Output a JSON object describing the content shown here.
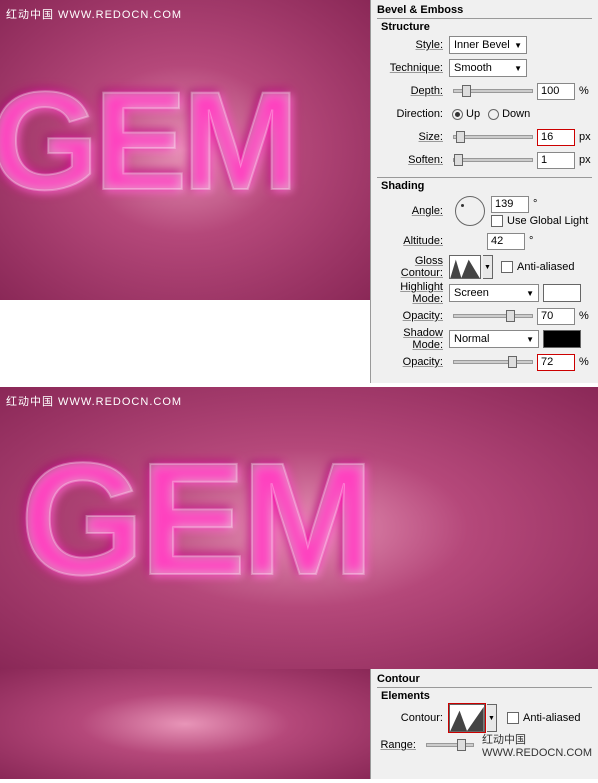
{
  "watermark": "红动中国 WWW.REDOCN.COM",
  "gemtext": "GEM",
  "panel1": {
    "title": "Bevel & Emboss",
    "structure": {
      "legend": "Structure",
      "style": {
        "label": "Style:",
        "value": "Inner Bevel"
      },
      "technique": {
        "label": "Technique:",
        "value": "Smooth"
      },
      "depth": {
        "label": "Depth:",
        "value": "100",
        "unit": "%"
      },
      "direction": {
        "label": "Direction:",
        "up": "Up",
        "down": "Down"
      },
      "size": {
        "label": "Size:",
        "value": "16",
        "unit": "px"
      },
      "soften": {
        "label": "Soften:",
        "value": "1",
        "unit": "px"
      }
    },
    "shading": {
      "legend": "Shading",
      "angle": {
        "label": "Angle:",
        "value": "139",
        "unit": "°"
      },
      "globalLight": "Use Global Light",
      "altitude": {
        "label": "Altitude:",
        "value": "42",
        "unit": "°"
      },
      "glossContour": {
        "label": "Gloss Contour:",
        "antiAliased": "Anti-aliased"
      },
      "highlightMode": {
        "label": "Highlight Mode:",
        "value": "Screen"
      },
      "highlightOpacity": {
        "label": "Opacity:",
        "value": "70",
        "unit": "%"
      },
      "shadowMode": {
        "label": "Shadow Mode:",
        "value": "Normal"
      },
      "shadowOpacity": {
        "label": "Opacity:",
        "value": "72",
        "unit": "%"
      }
    }
  },
  "panel2": {
    "title": "Contour",
    "elements": {
      "legend": "Elements",
      "contour": {
        "label": "Contour:",
        "antiAliased": "Anti-aliased"
      },
      "range": {
        "label": "Range:"
      }
    }
  }
}
